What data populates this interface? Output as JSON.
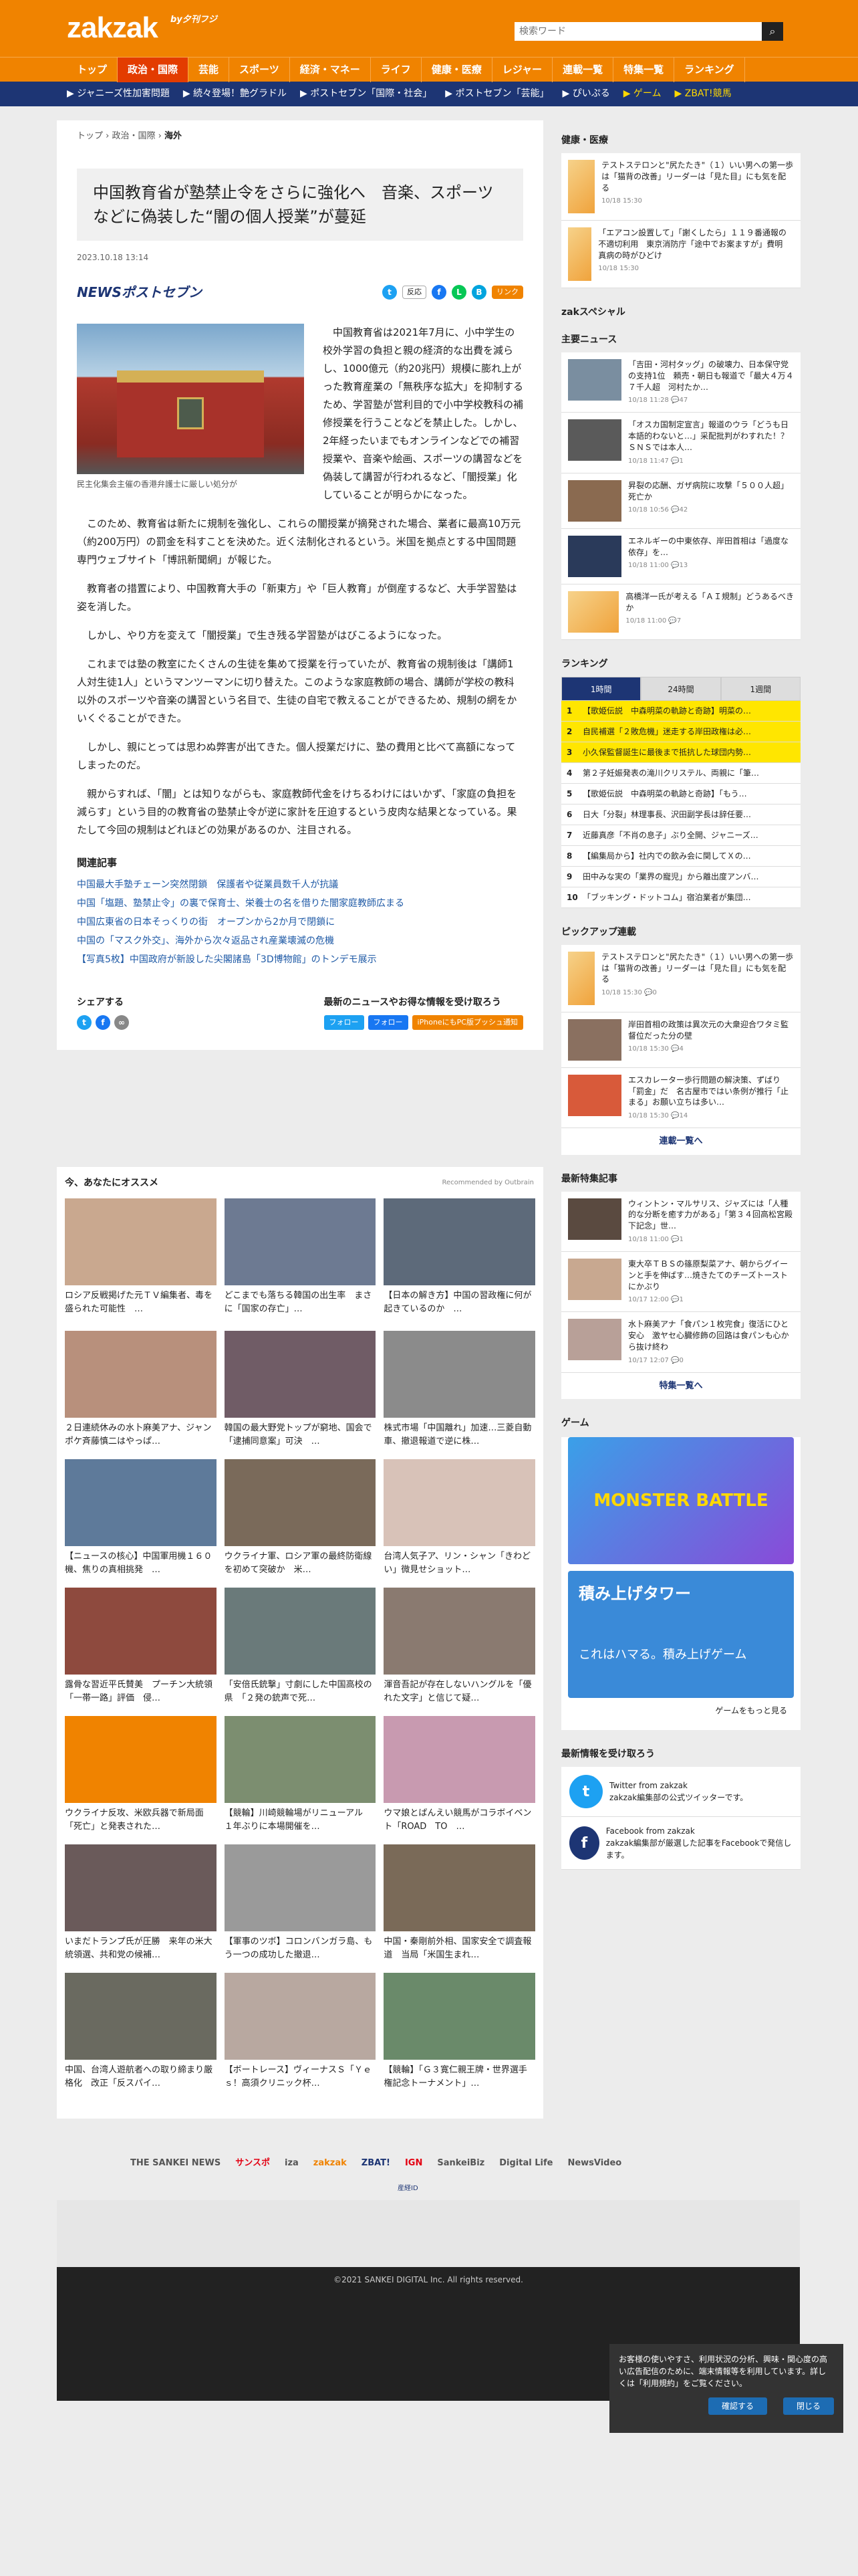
{
  "header": {
    "logo": "zakzak",
    "logo_sub": "by夕刊フジ",
    "search_placeholder": "検索ワード",
    "search_icon": "search-icon"
  },
  "gnav": [
    "トップ",
    "政治・国際",
    "芸能",
    "スポーツ",
    "経済・マネー",
    "ライフ",
    "健康・医療",
    "レジャー",
    "連載一覧",
    "特集一覧",
    "ランキング"
  ],
  "subnav": [
    "ジャニーズ性加害問題",
    "続々登場！艶グラドル",
    "ポストセブン「国際・社会」",
    "ポストセブン「芸能」",
    "ぴいぷる",
    "ゲーム",
    "ZBAT!競馬"
  ],
  "crumb": [
    "トップ",
    "政治・国際",
    "海外"
  ],
  "article": {
    "title": "中国教育省が塾禁止令をさらに強化へ　音楽、スポーツなどに偽装した“闇の個人授業”が蔓延",
    "date": "2023.10.18 13:14",
    "source": "NEWSポストセブン",
    "react": "反応",
    "copy": "リンク",
    "caption": "民主化集会主催の香港弁護士に厳しい処分が",
    "paragraphs": [
      "中国教育省は2021年7月に、小中学生の校外学習の負担と親の経済的な出費を減らし、1000億元（約20兆円）規模に膨れ上がった教育産業の「無秩序な拡大」を抑制するため、学習塾が営利目的で小中学校教科の補修授業を行うことなどを禁止した。しかし、2年経ったいまでもオンラインなどでの補習授業や、音楽や絵画、スポーツの講習などを偽装して講習が行われるなど、「闇授業」化していることが明らかになった。",
      "このため、教育省は新たに規制を強化し、これらの闇授業が摘発された場合、業者に最高10万元（約200万円）の罰金を科すことを決めた。近く法制化されるという。米国を拠点とする中国問題専門ウェブサイト「博訊新聞網」が報じた。",
      "教育者の措置により、中国教育大手の「新東方」や「巨人教育」が倒産するなど、大手学習塾は姿を消した。",
      "しかし、やり方を変えて「闇授業」で生き残る学習塾がはびこるようになった。",
      "これまでは塾の教室にたくさんの生徒を集めて授業を行っていたが、教育省の規制後は「講師1人対生徒1人」というマンツーマンに切り替えた。このような家庭教師の場合、講師が学校の教科以外のスポーツや音楽の講習という名目で、生徒の自宅で教えることができるため、規制の網をかいくぐることができた。",
      "しかし、親にとっては思わぬ弊害が出てきた。個人授業だけに、塾の費用と比べて高額になってしまったのだ。",
      "親からすれば、「闇」とは知りながらも、家庭教師代金をけちるわけにはいかず、「家庭の負担を減らす」という目的の教育省の塾禁止令が逆に家計を圧迫するという皮肉な結果となっている。果たして今回の規制はどれほどの効果があるのか、注目される。"
    ]
  },
  "related": {
    "title": "関連記事",
    "items": [
      "中国最大手塾チェーン突然閉鎖　保護者や従業員数千人が抗議",
      "中国「塩題、塾禁止令」の裏で保育士、栄養士の名を借りた闇家庭教師広まる",
      "中国広東省の日本そっくりの街　オープンから2か月で閉鎖に",
      "中国の「マスク外交」、海外から次々返品され産業壊滅の危機",
      "【写真5枚】中国政府が新設した尖閣諸島「3D博物館」のトンデモ展示"
    ]
  },
  "follow": {
    "share": "シェアする",
    "news": "最新のニュースやお得な情報を受け取ろう",
    "btn1": "フォロー",
    "btn2": "フォロー",
    "btn3": "iPhoneにもPC版プッシュ通知"
  },
  "rec": {
    "title": "今、あなたにオススメ",
    "by": "Recommended by Outbrain",
    "top": [
      "ロシア反戦掲げた元ＴＶ編集者、毒を盛られた可能性　…",
      "どこまでも落ちる韓国の出生率　まさに「国家の存亡」…",
      "【日本の解き方】中国の習政権に何が起きているのか　…"
    ],
    "grid": [
      "２日連続休みの水卜麻美アナ、ジャンポケ斉藤慎二はやっぱ…",
      "韓国の最大野党トップが窮地、国会で「逮捕同意案」可決　…",
      "株式市場「中国離れ」加速…三菱自動車、撤退報道で逆に株…",
      "【ニュースの核心】中国軍用機１６０機、焦りの真相挑発　…",
      "ウクライナ軍、ロシア軍の最終防衛線を初めて突破か　米…",
      "台湾人気子ア、リン・シャン「きわどい」微見せショット…",
      "露骨な習近平氏賛美　プーチン大統領「一帯一路」評価　侵…",
      "「安倍氏銃撃」寸劇にした中国高校の県　「２発の銃声で死…",
      "渾音吾記が存在しないハングルを「優れた文字」と信じて疑…",
      "ウクライナ反攻、米欧兵器で新局面　「死亡」と発表された…",
      "【競輪】川崎競輪場がリニューアル　１年ぶりに本場開催を…",
      "ウマ娘とばんえい競馬がコラボイベント「ROAD　TO　…",
      "いまだトランプ氏が圧勝　来年の米大統領選、共和党の候補…",
      "【軍事のツボ】コロンバンガラ島、もう一つの成功した撤退…",
      "中国・秦剛前外相、国家安全で調査報道　当局「米国生まれ…",
      "中国、台湾人遊航者への取り締まり厳格化　改正「反スパイ…",
      "【ボートレース】ヴィーナスＳ「Ｙｅｓ！高須クリニック杯…",
      "【競輪】「Ｇ３寛仁親王牌・世界選手権記念トーナメント」…"
    ]
  },
  "brands": [
    "THE SANKEI NEWS",
    "サンスポ",
    "iza",
    "zakzak",
    "ZBAT!",
    "IGN",
    "SankeiBiz",
    "Digital Life",
    "NewsVideo",
    "産経ID"
  ],
  "footer": "©2021 SANKEI DIGITAL Inc. All rights reserved.",
  "side": {
    "health_title": "健康・医療",
    "health": [
      {
        "t": "テストステロンと\"尻たたき\"（１）いい男への第一歩は「猫背の改善」リーダーは「見た目」にも気を配る",
        "d": "10/18 15:30"
      },
      {
        "t": "「エアコン設置して」「謝くしたら」１１９番通報の不適切利用　東京消防庁「途中でお案ますが」費明　真病の時がひどけ",
        "d": "10/18 15:30"
      }
    ],
    "special": "zakスペシャル",
    "main_title": "主要ニュース",
    "main": [
      {
        "t": "「吉田・河村タッグ」の破壊力、日本保守党の支持1位　頼売・朝日も報道で「最大４万４７千人超　河村たか…",
        "d": "10/18 11:28",
        "c": "47"
      },
      {
        "t": "「オスカ国制定宣言」報道のウラ「どうも日本語的わないと…」采配批判がわすれた！？　ＳＮＳでは本人…",
        "d": "10/18 11:47",
        "c": "1"
      },
      {
        "t": "昇裂の応酬、ガザ病院に攻撃「５００人超」死亡か",
        "d": "10/18 10:56",
        "c": "42"
      },
      {
        "t": "エネルギーの中東依存、岸田首相は「過度な依存」を…",
        "d": "10/18 11:00",
        "c": "13"
      },
      {
        "t": "高橋洋一氏が考える「ＡＩ規制」どうあるべきか",
        "d": "10/18 11:00",
        "c": "7"
      }
    ],
    "ranking_title": "ランキング",
    "tabs": [
      "1時間",
      "24時間",
      "1週間"
    ],
    "ranking": [
      "【歌姫伝説　中森明菜の軌跡と奇跡】明菜の…",
      "自民補選「２敗危機」迷走する岸田政権は必…",
      "小久保監督誕生に最後まで抵抗した球団内勢…",
      "第２子妊娠発表の滝川クリステル、両親に「筆…",
      "【歌姫伝説　中森明菜の軌跡と奇跡】「もう…",
      "日大「分裂」林理事長、沢田副学長は辞任要…",
      "近藤真彦「不肖の息子」ぶり全開、ジャニーズ…",
      "【編集局から】社内での飲み会に関してＸの…",
      "田中みな実の「業界の寵児」から離出度アンバ…",
      "「ブッキング・ドットコム」宿泊業者が集団…"
    ],
    "pickup_title": "ピックアップ連載",
    "pickup": [
      {
        "t": "テストステロンと\"尻たたき\"（１）いい男への第一歩は「猫背の改善」リーダーは「見た目」にも気を配る",
        "d": "10/18 15:30",
        "c": "0"
      },
      {
        "t": "岸田首相の政策は異次元の大衆迎合ワタミ監督位だった分の壁",
        "d": "10/18 15:30",
        "c": "4"
      },
      {
        "t": "エスカレーター歩行問題の解決策、ずばり「罰金」だ　名古屋市ではい条例が推行「止まる」お願い立ちは多い…",
        "d": "10/18 15:30",
        "c": "14"
      }
    ],
    "pickup_more": "連載一覧へ",
    "feature_title": "最新特集記事",
    "feature": [
      {
        "t": "ウィントン・マルサリス、ジャズには「人種的な分断を癒す力がある」「第３４回高松宮殿下記念」世…",
        "d": "10/18 11:00",
        "c": "1"
      },
      {
        "t": "東大卒ＴＢＳの篠原梨菜アナ、朝からグイーンと手を伸ばす…焼きたてのチーズトーストにかぶり",
        "d": "10/17 12:00",
        "c": "1"
      },
      {
        "t": "水卜麻美アナ「食パン１枚完食」復活にひと安心　激ヤセ心臓修飾の回路は食パンも心から抜け終わ",
        "d": "10/17 12:07",
        "c": "0"
      }
    ],
    "feature_more": "特集一覧へ",
    "game_title": "ゲーム",
    "game1": "MONSTER BATTLE",
    "game2": "積み上げタワー",
    "game2_sub": "これはハマる。積み上げゲーム",
    "game_more": "ゲームをもっと見る",
    "recv_title": "最新情報を受け取ろう",
    "recv_tw": "Twitter from zakzak",
    "recv_tw_sub": "zakzak編集部の公式ツイッターです。",
    "recv_fb": "Facebook from zakzak",
    "recv_fb_sub": "zakzak編集部が厳選した記事をFacebookで発信します。"
  },
  "cookie": {
    "text": "お客様の使いやすさ、利用状況の分析、興味・関心度の高い広告配信のために、端末情報等を利用しています。詳しくは「利用規約」をご覧ください。",
    "ok": "確認する",
    "close": "閉じる"
  },
  "colors": {
    "brand": "#f08300",
    "navy": "#1d3574",
    "active": "#e33c00"
  }
}
